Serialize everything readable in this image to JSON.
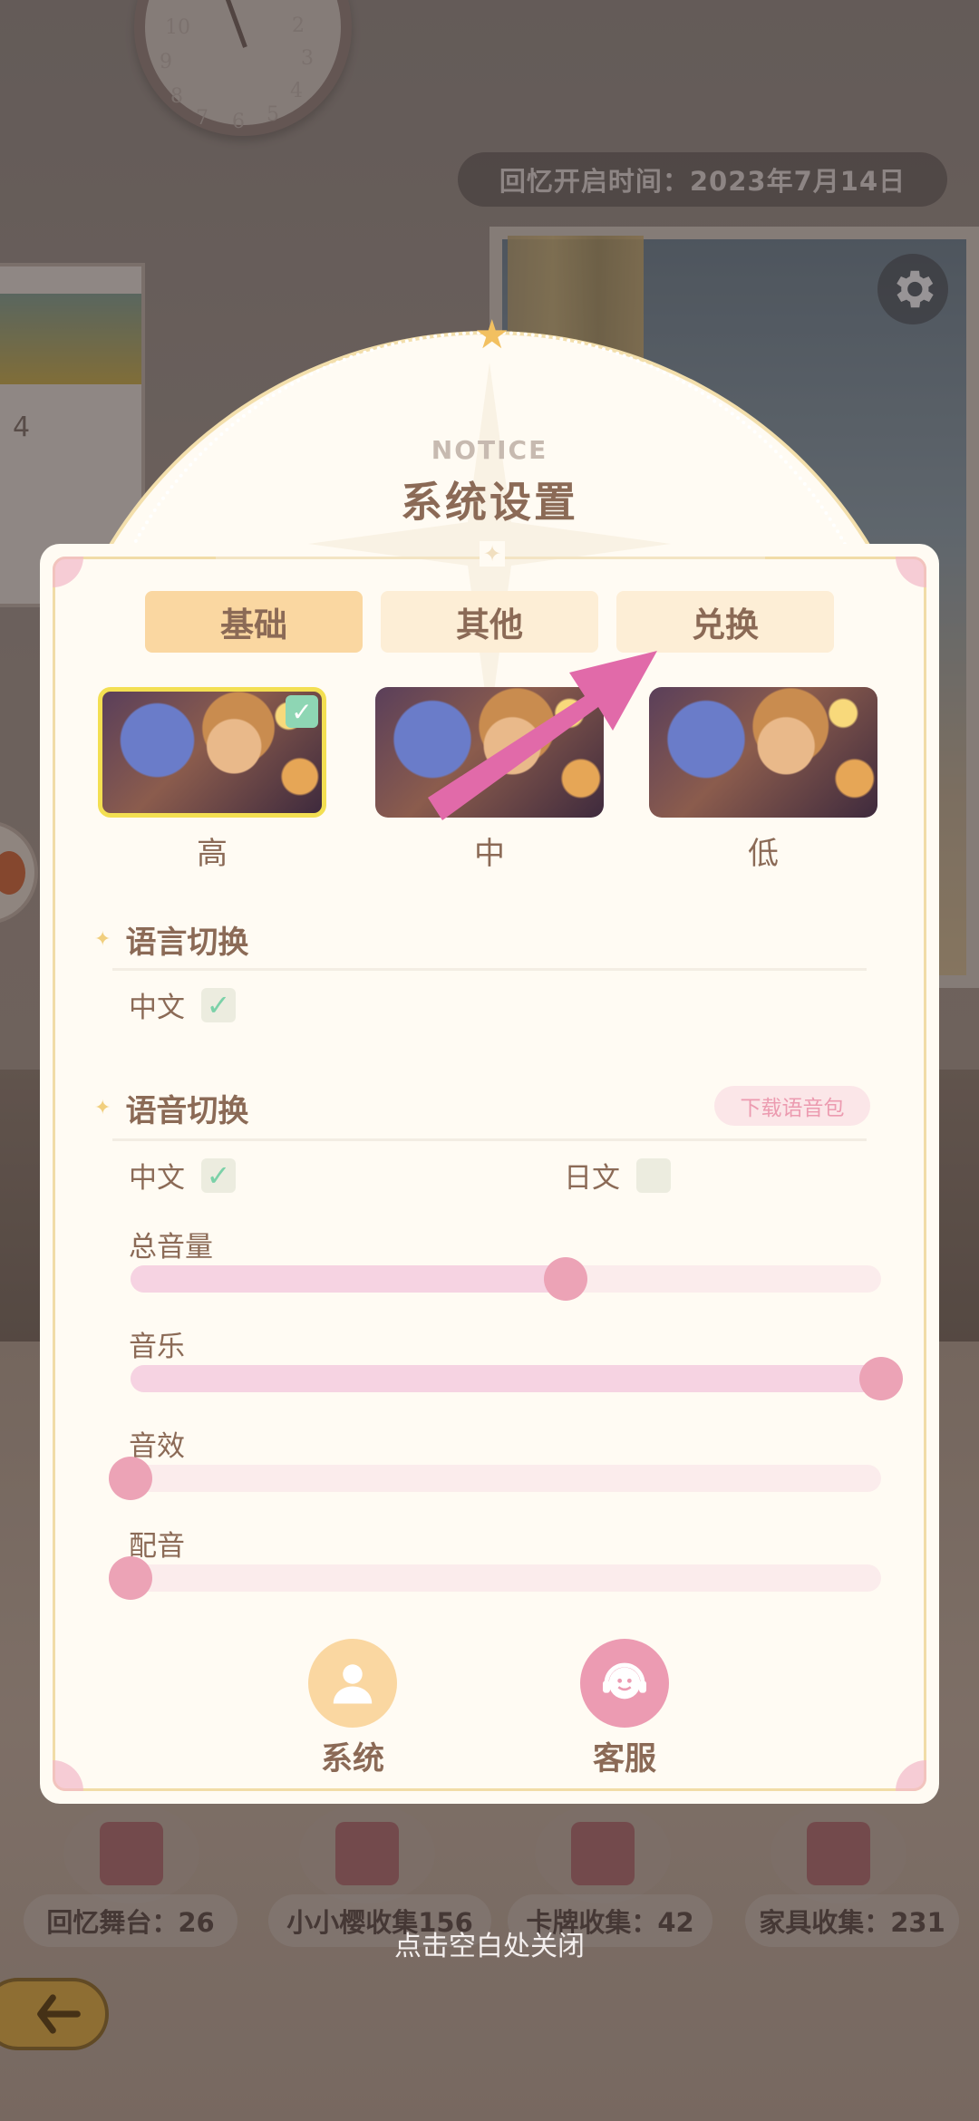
{
  "header": {
    "date_text": "回忆开启时间：2023年7月14日"
  },
  "background_clock": {
    "numerals": [
      "10",
      "9",
      "8",
      "7",
      "6",
      "5",
      "4",
      "3",
      "2"
    ]
  },
  "background_calendar": {
    "number": "4"
  },
  "dialog": {
    "notice": "NOTICE",
    "title": "系统设置",
    "tabs": [
      {
        "label": "基础",
        "active": true
      },
      {
        "label": "其他",
        "active": false
      },
      {
        "label": "兑换",
        "active": false
      }
    ],
    "quality": [
      {
        "label": "高",
        "selected": true
      },
      {
        "label": "中",
        "selected": false
      },
      {
        "label": "低",
        "selected": false
      }
    ],
    "language": {
      "title": "语言切换",
      "options": [
        {
          "label": "中文",
          "checked": true
        }
      ]
    },
    "voice": {
      "title": "语音切换",
      "download_label": "下载语音包",
      "options": [
        {
          "label": "中文",
          "checked": true
        },
        {
          "label": "日文",
          "checked": false
        }
      ]
    },
    "sliders": [
      {
        "label": "总音量",
        "value": 0.58
      },
      {
        "label": "音乐",
        "value": 1.0
      },
      {
        "label": "音效",
        "value": 0.0
      },
      {
        "label": "配音",
        "value": 0.0
      }
    ],
    "bottom_buttons": [
      {
        "label": "系统",
        "icon": "person-icon"
      },
      {
        "label": "客服",
        "icon": "headset-icon"
      }
    ]
  },
  "stats": [
    {
      "label": "回忆舞台：26"
    },
    {
      "label": "小小樱收集156"
    },
    {
      "label": "卡牌收集：42"
    },
    {
      "label": "家具收集：231"
    }
  ],
  "close_hint": "点击空白处关闭",
  "colors": {
    "accent_pink": "#eca3b6",
    "tab_active": "#fad7a1",
    "text_brown": "#8b6a56",
    "check_green": "#7bd1a8",
    "arrow_magenta": "#e16aa9"
  }
}
